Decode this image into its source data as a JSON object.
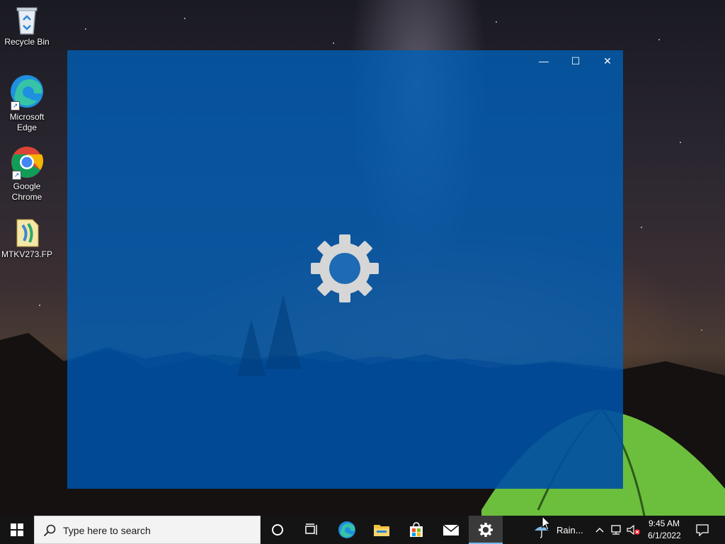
{
  "desktop": {
    "icons": [
      {
        "label": "Recycle Bin",
        "icon": "recycle-bin-icon"
      },
      {
        "label": "Microsoft Edge",
        "icon": "edge-icon"
      },
      {
        "label": "Google Chrome",
        "icon": "chrome-icon"
      },
      {
        "label": "MTKV273.FP",
        "icon": "file-icon"
      }
    ]
  },
  "window": {
    "app": "Settings",
    "splash_icon": "gear-icon",
    "controls": {
      "minimize": "minimize-icon",
      "maximize": "maximize-icon",
      "close": "close-icon"
    },
    "accent": "#005fb8"
  },
  "taskbar": {
    "start_icon": "windows-logo-icon",
    "search_placeholder": "Type here to search",
    "pinned": [
      "cortana-icon",
      "task-view-icon",
      "edge-icon",
      "file-explorer-icon",
      "store-icon",
      "mail-icon",
      "settings-icon"
    ],
    "active_app": "settings",
    "weather": {
      "text": "Rain...",
      "icon": "umbrella-icon"
    },
    "tray_icons": [
      "chevron-up-icon",
      "network-icon",
      "volume-muted-icon"
    ],
    "clock": {
      "time": "9:45 AM",
      "date": "6/1/2022"
    },
    "notification_icon": "action-center-icon"
  }
}
